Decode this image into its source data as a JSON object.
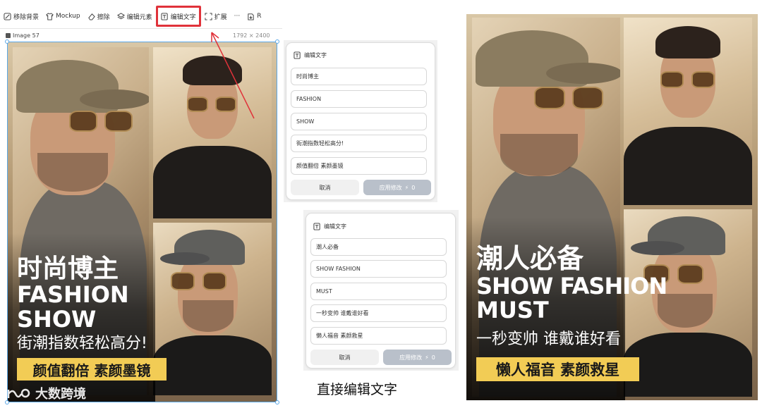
{
  "toolbar": {
    "items": [
      {
        "label": "移除背景",
        "icon": "remove-background-icon"
      },
      {
        "label": "Mockup",
        "icon": "shirt-icon"
      },
      {
        "label": "擦除",
        "icon": "eraser-icon"
      },
      {
        "label": "编辑元素",
        "icon": "layers-icon"
      },
      {
        "label": "编辑文字",
        "icon": "text-edit-icon",
        "highlighted": true
      },
      {
        "label": "扩展",
        "icon": "expand-icon"
      },
      {
        "label": "···",
        "icon": "more-icon"
      },
      {
        "label": "R",
        "icon": "export-icon"
      }
    ]
  },
  "image_meta": {
    "name": "Image 57",
    "dimensions": "1792 × 2400"
  },
  "poster_left": {
    "line1": "时尚博主",
    "line2": "FASHION",
    "line3": "SHOW",
    "line4": "街潮指数轻松高分!",
    "tag": "颜值翻倍 素颜墨镜"
  },
  "poster_right": {
    "line1": "潮人必备",
    "line2": "SHOW FASHION",
    "line3": "MUST",
    "line4": "一秒变帅 谁戴谁好看",
    "tag": "懒人福音 素颜救星"
  },
  "panel_top": {
    "title": "编辑文字",
    "fields": [
      "时尚博主",
      "FASHION",
      "SHOW",
      "街潮指数轻松高分!",
      "颜值翻倍 素颜墨镜"
    ],
    "cancel_label": "取消",
    "apply_label": "应用修改",
    "apply_cost": "0"
  },
  "panel_bottom": {
    "title": "编辑文字",
    "fields": [
      "潮人必备",
      "SHOW FASHION",
      "MUST",
      "一秒变帅 谁戴谁好看",
      "懒人福音 素颜救星"
    ],
    "cancel_label": "取消",
    "apply_label": "应用修改",
    "apply_cost": "0"
  },
  "caption": "直接编辑文字",
  "watermark": "大数跨境",
  "colors": {
    "highlight_red": "#e0323a",
    "tag_yellow": "#f2cc55",
    "selection_blue": "#5aa7e6",
    "apply_button_gray": "#b9c0ca"
  }
}
